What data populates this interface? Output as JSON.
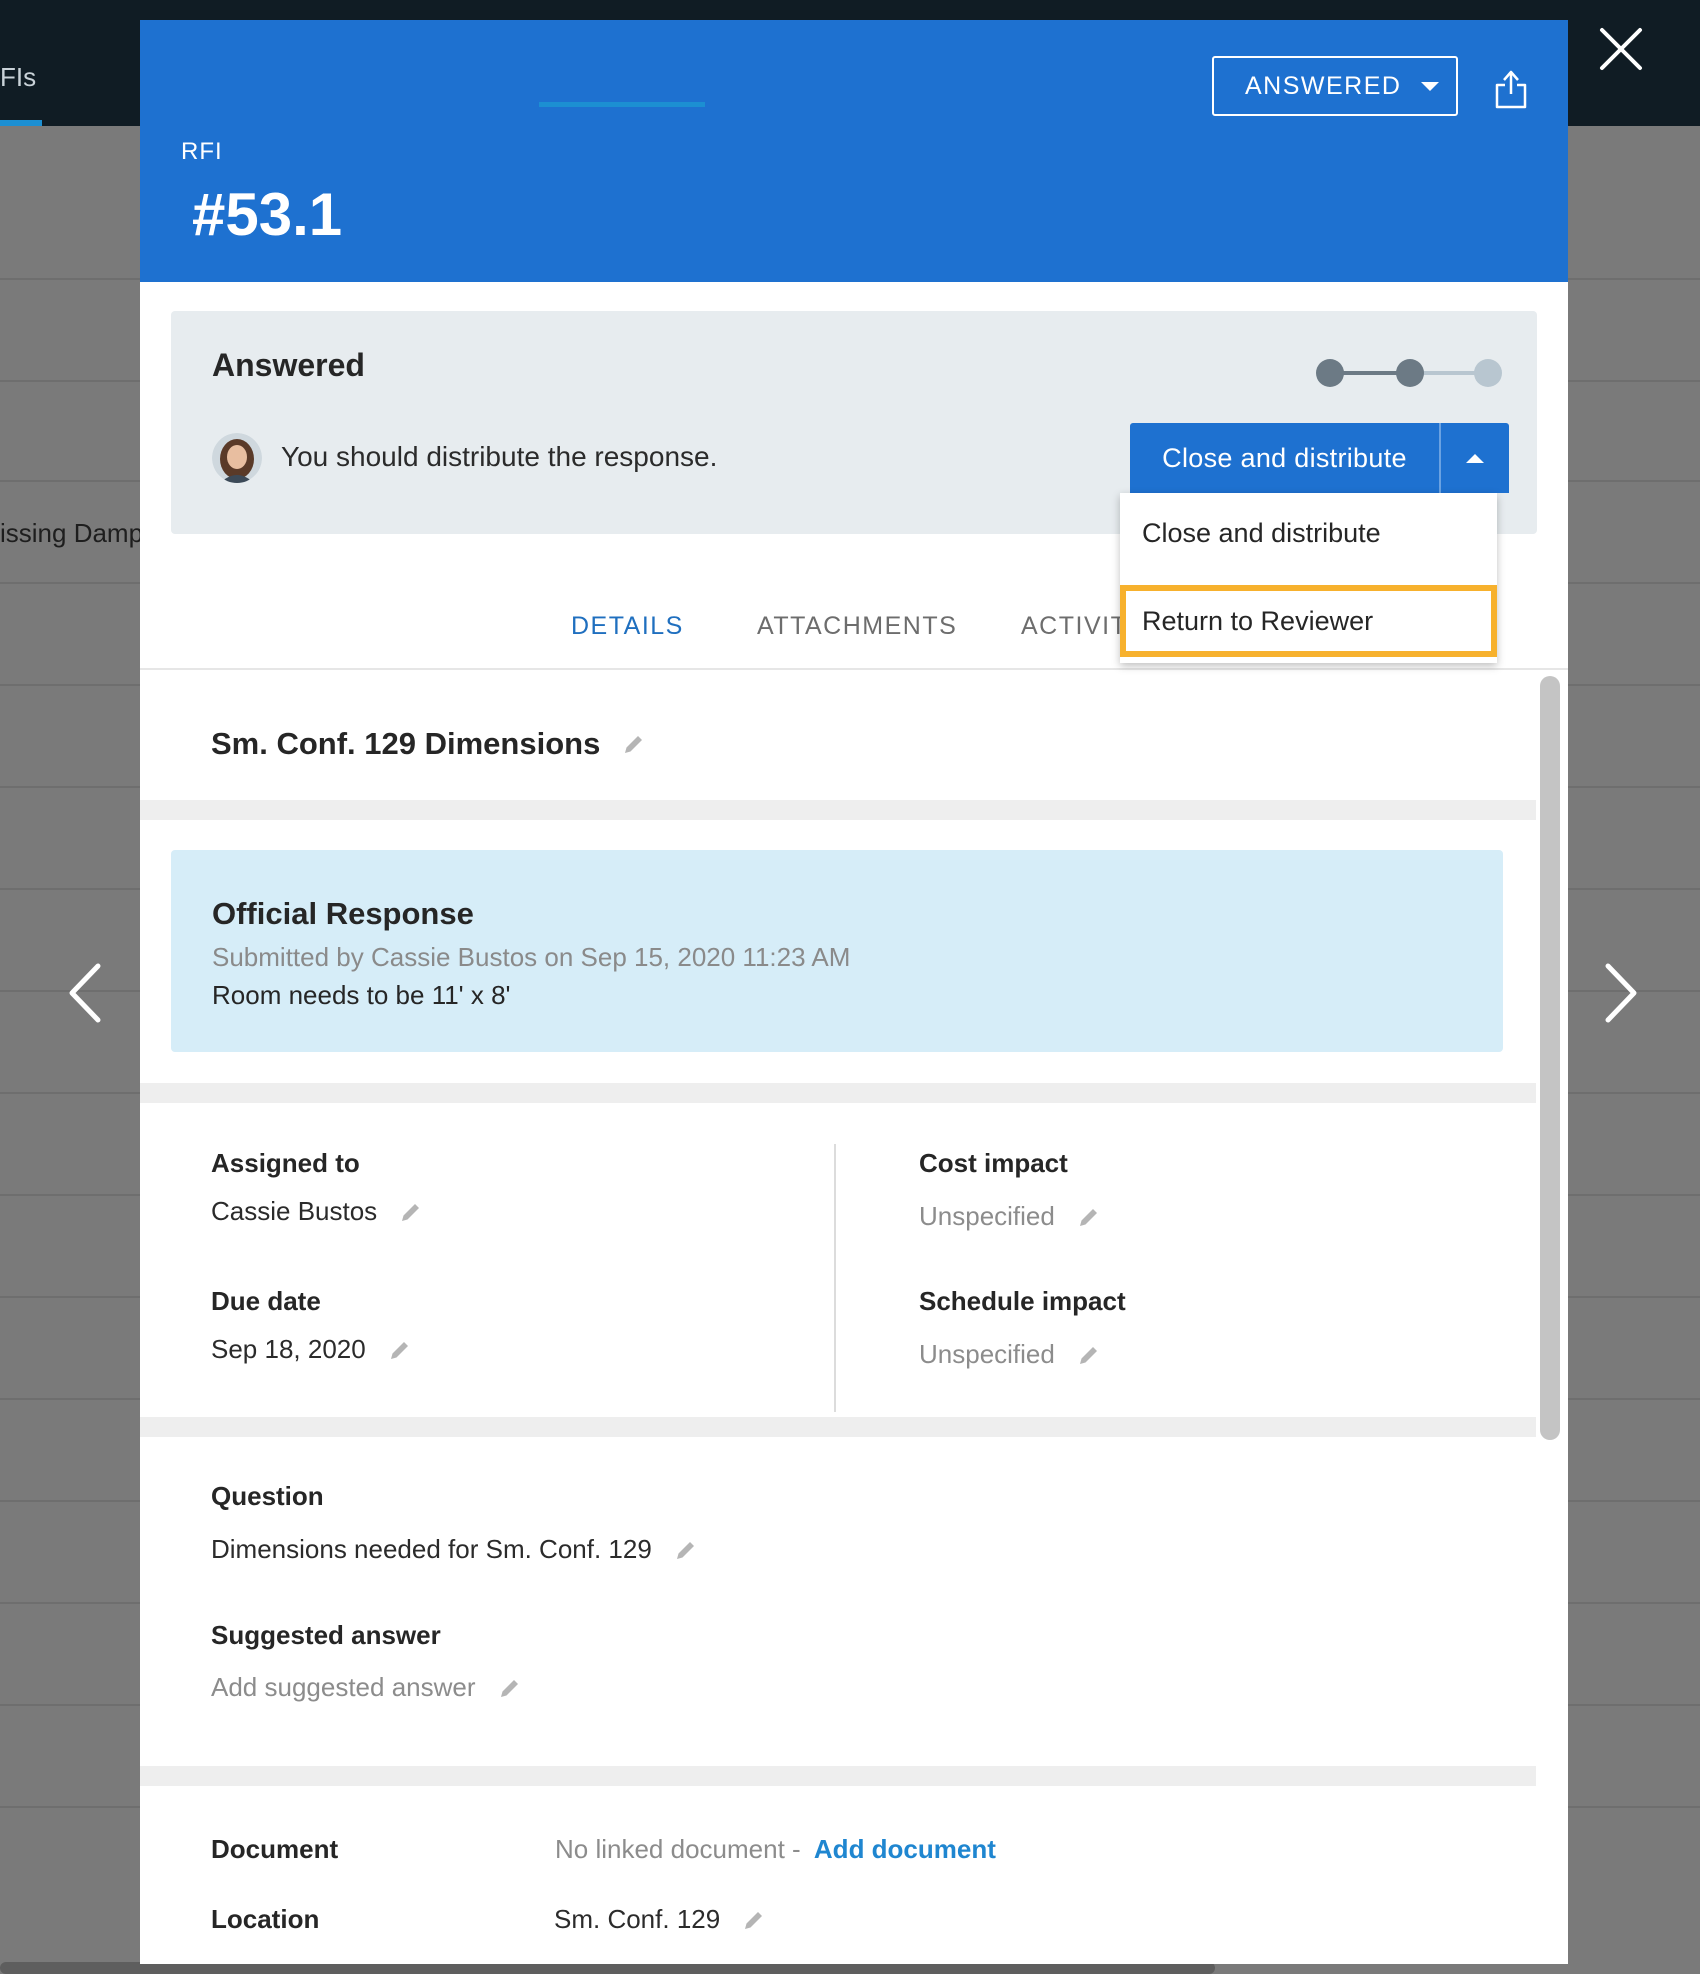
{
  "background": {
    "tab_fragment": "FIs",
    "row_fragment": "issing Damp"
  },
  "header": {
    "label": "RFI",
    "number": "#53.1",
    "status_button": "ANSWERED"
  },
  "workflow": {
    "title": "Answered",
    "message": "You should distribute the response.",
    "primary_action": "Close and distribute",
    "menu_items": [
      "Close and distribute",
      "Return to Reviewer"
    ],
    "highlighted_item": "Return to Reviewer",
    "steps_total": 3,
    "steps_completed": 2
  },
  "tabs": [
    {
      "label": "DETAILS",
      "active": true
    },
    {
      "label": "ATTACHMENTS",
      "active": false
    },
    {
      "label": "ACTIVIT",
      "active": false
    }
  ],
  "subject": "Sm. Conf. 129 Dimensions",
  "official_response": {
    "title": "Official Response",
    "submitted": "Submitted by Cassie Bustos on Sep 15, 2020 11:23 AM",
    "text": "Room needs to be 11' x 8'"
  },
  "fields": {
    "assigned_to": {
      "label": "Assigned to",
      "value": "Cassie Bustos"
    },
    "due_date": {
      "label": "Due date",
      "value": "Sep 18, 2020"
    },
    "cost_impact": {
      "label": "Cost impact",
      "value": "Unspecified"
    },
    "schedule_impact": {
      "label": "Schedule impact",
      "value": "Unspecified"
    },
    "question": {
      "label": "Question",
      "value": "Dimensions needed for Sm. Conf. 129"
    },
    "suggested_answer": {
      "label": "Suggested answer",
      "placeholder": "Add suggested answer"
    },
    "document": {
      "label": "Document",
      "value": "No linked document - ",
      "link": "Add document"
    },
    "location": {
      "label": "Location",
      "value": "Sm. Conf. 129"
    }
  },
  "colors": {
    "header_blue": "#1e71d0",
    "accent_blue": "#1c8fd2",
    "highlight_orange": "#f7b12d",
    "panel_gray": "#e7ecef",
    "response_blue": "#d6edf8"
  }
}
